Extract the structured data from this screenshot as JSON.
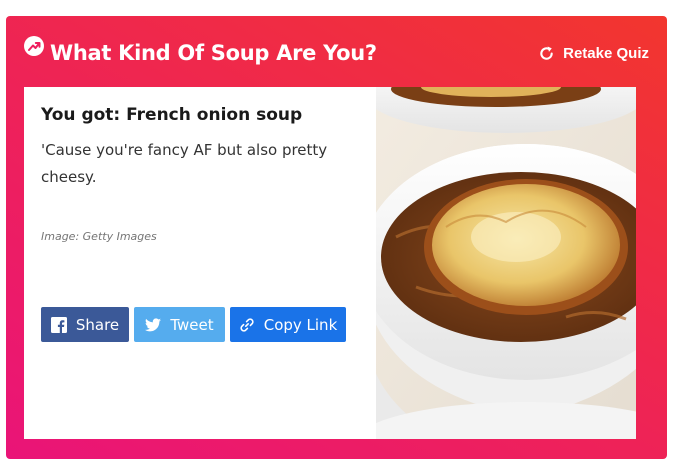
{
  "quiz": {
    "title": "What Kind Of Soup Are You?",
    "retake_label": "Retake Quiz"
  },
  "result": {
    "title": "You got: French onion soup",
    "description": "'Cause you're fancy AF but also pretty cheesy.",
    "image_credit": "Image: Getty Images"
  },
  "share": {
    "facebook_label": "Share",
    "twitter_label": "Tweet",
    "copy_label": "Copy Link"
  },
  "icons": {
    "header": "trending-arrow-icon",
    "retake": "refresh-icon",
    "facebook": "facebook-icon",
    "twitter": "twitter-icon",
    "copy": "link-icon"
  },
  "colors": {
    "gradient_start": "#ea1478",
    "gradient_end": "#f2362e",
    "facebook": "#3b5998",
    "twitter": "#55acee",
    "copy_link": "#1a73e8"
  }
}
